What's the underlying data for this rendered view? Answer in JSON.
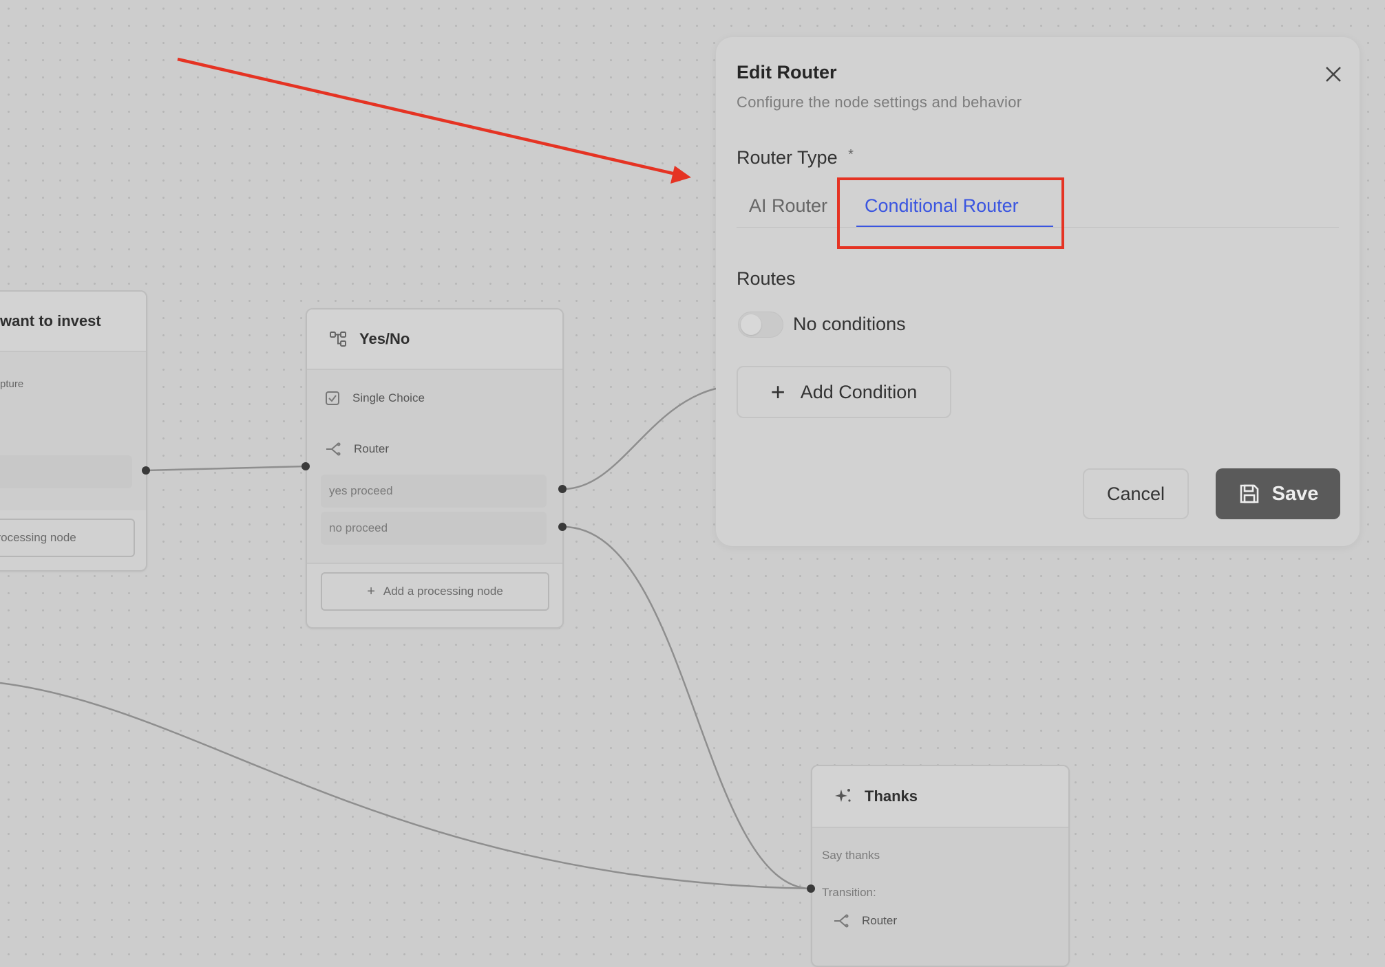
{
  "canvas": {
    "partial_node": {
      "title": "want to invest",
      "item_fragment": "pture",
      "add_node_label": "processing node"
    },
    "yesno_node": {
      "title": "Yes/No",
      "single_choice_label": "Single Choice",
      "router_label": "Router",
      "routes": [
        "yes proceed",
        "no proceed"
      ],
      "add_node_label": "Add a processing node"
    },
    "thanks_node": {
      "title": "Thanks",
      "description": "Say thanks",
      "transition_label": "Transition:",
      "router_label": "Router"
    }
  },
  "dialog": {
    "title": "Edit Router",
    "subtitle": "Configure the node settings and behavior",
    "router_type_label": "Router Type",
    "required_marker": "*",
    "tabs": [
      {
        "label": "AI Router",
        "active": false
      },
      {
        "label": "Conditional Router",
        "active": true
      }
    ],
    "routes_label": "Routes",
    "no_conditions_label": "No conditions",
    "add_condition_label": "Add Condition",
    "cancel_label": "Cancel",
    "save_label": "Save"
  },
  "annotation": {
    "color": "#e53323"
  },
  "colors": {
    "accent_blue": "#3a55e0",
    "save_button": "#5a5a5a"
  }
}
